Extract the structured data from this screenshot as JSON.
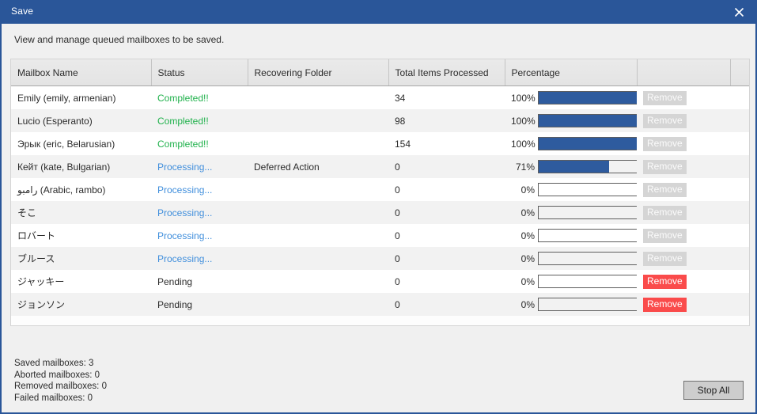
{
  "window": {
    "title": "Save",
    "close_icon": "close-icon",
    "accent_color": "#2a5699"
  },
  "description": "View and manage queued mailboxes to be saved.",
  "table": {
    "columns": [
      "Mailbox Name",
      "Status",
      "Recovering Folder",
      "Total Items Processed",
      "Percentage",
      "",
      ""
    ],
    "rows": [
      {
        "mailbox": "Emily (emily, armenian)",
        "status": "Completed!!",
        "status_kind": "completed",
        "folder": "",
        "items": "34",
        "percent_label": "100%",
        "percent": 100,
        "remove_label": "Remove",
        "remove_enabled": false
      },
      {
        "mailbox": "Lucio (Esperanto)",
        "status": "Completed!!",
        "status_kind": "completed",
        "folder": "",
        "items": "98",
        "percent_label": "100%",
        "percent": 100,
        "remove_label": "Remove",
        "remove_enabled": false
      },
      {
        "mailbox": "Эрык (eric, Belarusian)",
        "status": "Completed!!",
        "status_kind": "completed",
        "folder": "",
        "items": "154",
        "percent_label": "100%",
        "percent": 100,
        "remove_label": "Remove",
        "remove_enabled": false
      },
      {
        "mailbox": "Кейт (kate, Bulgarian)",
        "status": "Processing...",
        "status_kind": "processing",
        "folder": "Deferred Action",
        "items": "0",
        "percent_label": "71%",
        "percent": 71,
        "remove_label": "Remove",
        "remove_enabled": false
      },
      {
        "mailbox": "رامبو (Arabic, rambo)",
        "status": "Processing...",
        "status_kind": "processing",
        "folder": "",
        "items": "0",
        "percent_label": "0%",
        "percent": 0,
        "remove_label": "Remove",
        "remove_enabled": false
      },
      {
        "mailbox": "そこ",
        "status": "Processing...",
        "status_kind": "processing",
        "folder": "",
        "items": "0",
        "percent_label": "0%",
        "percent": 0,
        "remove_label": "Remove",
        "remove_enabled": false
      },
      {
        "mailbox": "ロバート",
        "status": "Processing...",
        "status_kind": "processing",
        "folder": "",
        "items": "0",
        "percent_label": "0%",
        "percent": 0,
        "remove_label": "Remove",
        "remove_enabled": false
      },
      {
        "mailbox": "ブルース",
        "status": "Processing...",
        "status_kind": "processing",
        "folder": "",
        "items": "0",
        "percent_label": "0%",
        "percent": 0,
        "remove_label": "Remove",
        "remove_enabled": false
      },
      {
        "mailbox": "ジャッキー",
        "status": "Pending",
        "status_kind": "pending",
        "folder": "",
        "items": "0",
        "percent_label": "0%",
        "percent": 0,
        "remove_label": "Remove",
        "remove_enabled": true
      },
      {
        "mailbox": "ジョンソン",
        "status": "Pending",
        "status_kind": "pending",
        "folder": "",
        "items": "0",
        "percent_label": "0%",
        "percent": 0,
        "remove_label": "Remove",
        "remove_enabled": true
      }
    ]
  },
  "summary": {
    "saved": "Saved mailboxes: 3",
    "aborted": "Aborted mailboxes: 0",
    "removed": "Removed mailboxes: 0",
    "failed": "Failed mailboxes: 0"
  },
  "footer": {
    "stop_all_label": "Stop All"
  },
  "colors": {
    "title_bar": "#2a5699",
    "progress_fill": "#2e5b9e",
    "status_completed": "#1fb14b",
    "status_processing": "#3f8edc",
    "remove_enabled": "#fa4b4b",
    "remove_disabled": "#d5d5d5"
  }
}
